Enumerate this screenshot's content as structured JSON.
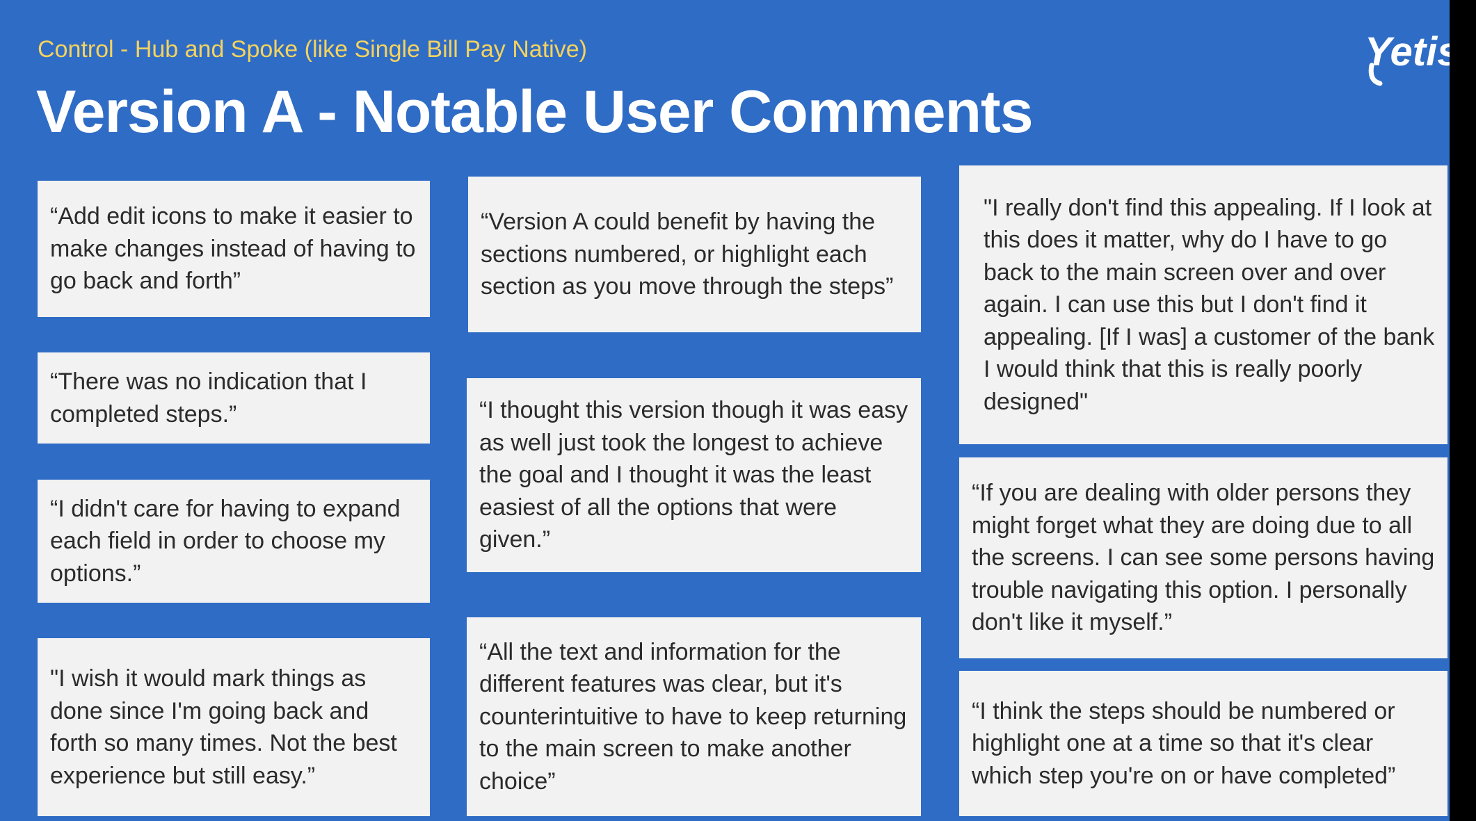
{
  "header": {
    "subtitle": "Control - Hub and Spoke (like Single Bill Pay Native)",
    "title": "Version A - Notable User Comments",
    "logo_text": "Yetis"
  },
  "comments": [
    "“Add edit icons to make it easier to make changes instead of having to go back and forth”",
    "“There was no indication that I completed steps.”",
    "“I didn't care for having to expand each field in order to choose my options.”",
    "\"I wish it would mark things as done since I'm going back and forth so many times. Not the best experience but still easy.”",
    "“Version A could benefit by having the sections numbered, or highlight each section as you move through the steps”",
    "“I thought this version though it was easy as well just took the longest to achieve the goal and I thought it was the least easiest of all the options that were given.”",
    "“All the text and information for the different features was clear, but it's counterintuitive to have to keep returning to the main screen to make another choice”",
    "\"I really don't find this appealing. If I look at this does it matter, why do I have to go back to the main screen over and over again. I can use this but I don't find it appealing. [If I was] a customer of the bank I would think that this is really poorly designed\"",
    "“If you are dealing with older persons they might forget what they are doing due to all the screens.  I can see some persons having trouble navigating this option.  I personally don't like it myself.”",
    "“I think the steps should be numbered or highlight one at a time so that it's clear which step you're on or have completed”"
  ],
  "colors": {
    "background": "#2f6cc5",
    "subtitle": "#f4d35e",
    "card": "#f2f2f2",
    "text": "#2b2b2b"
  }
}
